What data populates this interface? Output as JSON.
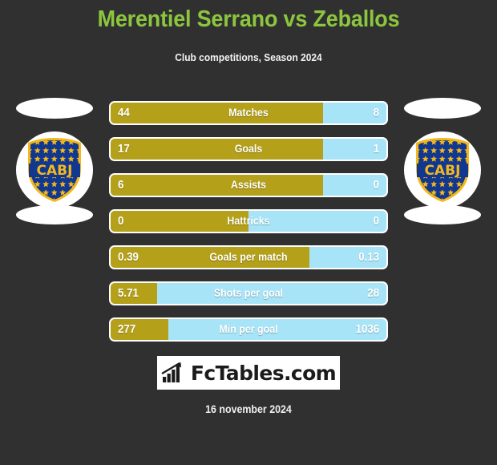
{
  "header": {
    "title": "Merentiel Serrano vs Zeballos",
    "subtitle": "Club competitions, Season 2024",
    "title_color": "#8cc63e"
  },
  "teams": {
    "left": {
      "crest_icon": "cabj-crest-icon",
      "crest_text": "CABJ"
    },
    "right": {
      "crest_icon": "cabj-crest-icon",
      "crest_text": "CABJ"
    }
  },
  "colors": {
    "background": "#303030",
    "left_bar": "#b5a019",
    "right_bar": "#a8e4f8",
    "bar_border": "#ffffff",
    "text_on_bar": "#ffffff"
  },
  "chart_data": {
    "type": "bar",
    "title": "Merentiel Serrano vs Zeballos",
    "subtitle": "Club competitions, Season 2024",
    "orientation": "horizontal-diverging",
    "legend": [
      "Merentiel Serrano",
      "Zeballos"
    ],
    "categories": [
      "Matches",
      "Goals",
      "Assists",
      "Hattricks",
      "Goals per match",
      "Shots per goal",
      "Min per goal"
    ],
    "series": [
      {
        "name": "Merentiel Serrano",
        "values": [
          44,
          17,
          6,
          0,
          0.39,
          5.71,
          277
        ]
      },
      {
        "name": "Zeballos",
        "values": [
          8,
          1,
          0,
          0,
          0.13,
          28,
          1036
        ]
      }
    ],
    "rows": [
      {
        "label": "Matches",
        "left": "44",
        "right": "8",
        "left_pct": 77
      },
      {
        "label": "Goals",
        "left": "17",
        "right": "1",
        "left_pct": 77
      },
      {
        "label": "Assists",
        "left": "6",
        "right": "0",
        "left_pct": 77
      },
      {
        "label": "Hattricks",
        "left": "0",
        "right": "0",
        "left_pct": 50
      },
      {
        "label": "Goals per match",
        "left": "0.39",
        "right": "0.13",
        "left_pct": 72
      },
      {
        "label": "Shots per goal",
        "left": "5.71",
        "right": "28",
        "left_pct": 17
      },
      {
        "label": "Min per goal",
        "left": "277",
        "right": "1036",
        "left_pct": 21
      }
    ]
  },
  "footer": {
    "logo_icon": "bar-chart-arrow-icon",
    "logo_text": "FcTables.com",
    "date": "16 november 2024"
  }
}
